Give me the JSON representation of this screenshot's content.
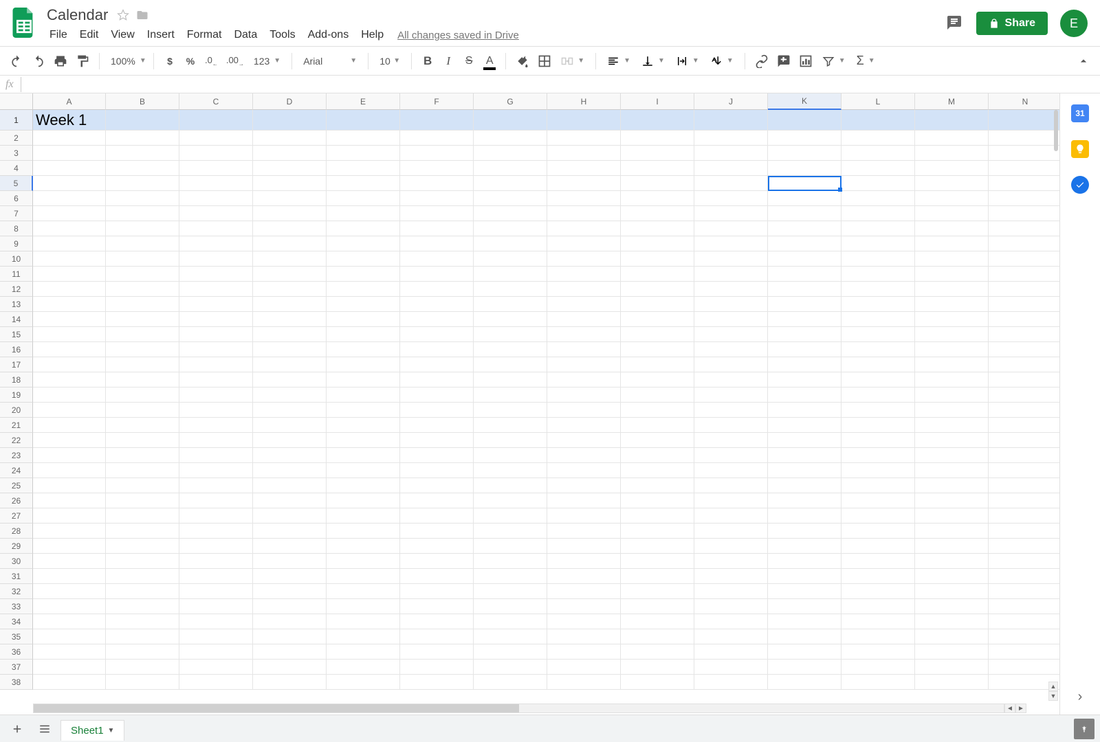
{
  "doc": {
    "title": "Calendar"
  },
  "menu": {
    "items": [
      "File",
      "Edit",
      "View",
      "Insert",
      "Format",
      "Data",
      "Tools",
      "Add-ons",
      "Help"
    ],
    "save_status": "All changes saved in Drive"
  },
  "header_right": {
    "share_label": "Share",
    "avatar_initial": "E"
  },
  "toolbar": {
    "zoom": "100%",
    "font": "Arial",
    "font_size": "10",
    "number_format": "123"
  },
  "formula_bar": {
    "fx": "fx",
    "value": ""
  },
  "grid": {
    "columns": [
      "A",
      "B",
      "C",
      "D",
      "E",
      "F",
      "G",
      "H",
      "I",
      "J",
      "K",
      "L",
      "M",
      "N"
    ],
    "col_widths": {
      "A": 106,
      "default": 107
    },
    "row_count": 38,
    "row1_height": 30,
    "active_cell": {
      "row": 5,
      "col": "K"
    },
    "selected_row_header": 1,
    "highlighted_row": 1,
    "cells": {
      "A1": "Week 1"
    }
  },
  "tabs": {
    "sheet_name": "Sheet1"
  },
  "side_panel": {
    "calendar_day": "31"
  }
}
